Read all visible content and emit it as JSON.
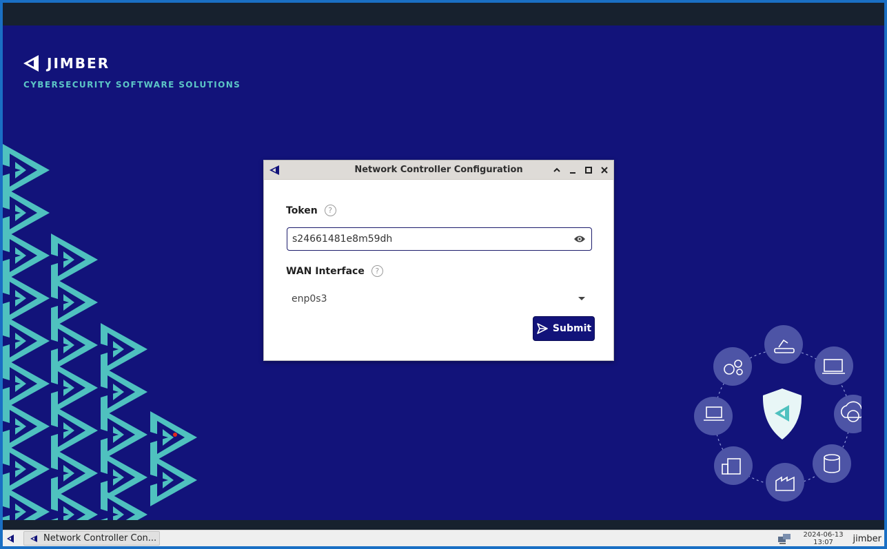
{
  "brand": {
    "name": "JIMBER",
    "tagline": "CYBERSECURITY SOFTWARE SOLUTIONS"
  },
  "dialog": {
    "title": "Network Controller Configuration",
    "token_label": "Token",
    "token_value": "s24661481e8m59dh",
    "wan_label": "WAN Interface",
    "wan_value": "enp0s3",
    "submit_label": "Submit",
    "help_glyph": "?"
  },
  "taskbar": {
    "task_label": "Network Controller Con...",
    "date": "2024-06-13",
    "time": "13:07",
    "user": "jimber"
  },
  "colors": {
    "background": "#12137a",
    "accent": "#5cc6c6",
    "titlebar": "#dedbd7",
    "submit": "#12137a"
  },
  "icons": [
    "jimber-logo-icon",
    "chevron-up-icon",
    "minimize-icon",
    "maximize-icon",
    "close-icon",
    "help-icon",
    "eye-icon",
    "dropdown-caret-icon",
    "send-icon",
    "network-tray-icon"
  ]
}
